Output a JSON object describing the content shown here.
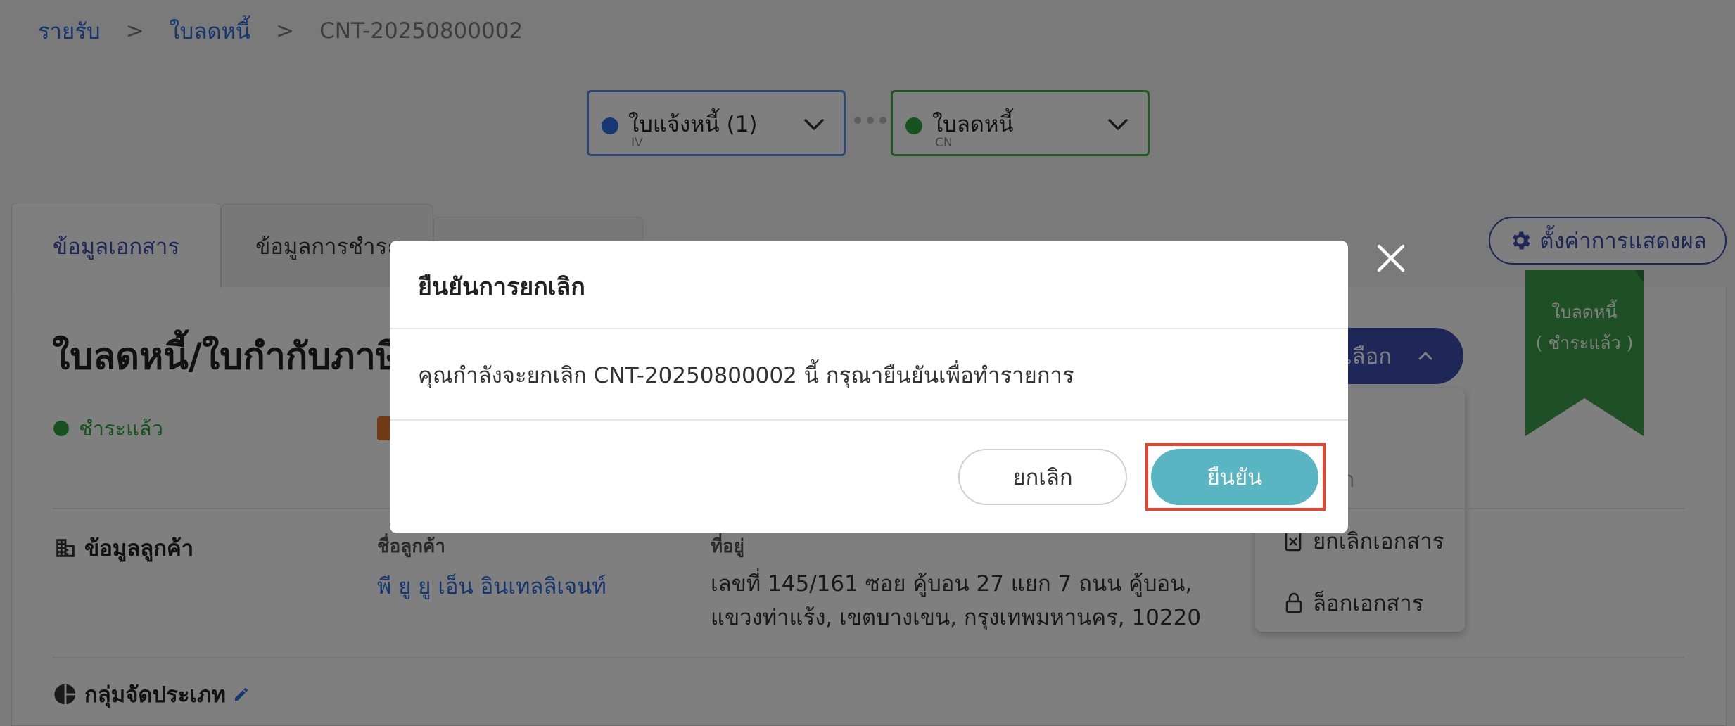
{
  "breadcrumb": {
    "items": [
      "รายรับ",
      "ใบลดหนี้",
      "CNT-20250800002"
    ],
    "separator": ">"
  },
  "doc_flow": {
    "invoice": {
      "title": "ใบแจ้งหนี้ (1)",
      "code": "IV"
    },
    "credit_note": {
      "title": "ใบลดหนี้",
      "code": "CN"
    }
  },
  "tabs": [
    "ข้อมูลเอกสาร",
    "ข้อมูลการชำระ"
  ],
  "settings_button": "ตั้งค่าการแสดงผล",
  "document": {
    "title": "ใบลดหนี้/ใบกำกับภาษี เล",
    "status": "ชำระแล้ว",
    "ribbon_line1": "ใบลดหนี้",
    "ribbon_line2": "( ชำระแล้ว )"
  },
  "options_menu": {
    "button_label": "เลือก",
    "items": [
      "",
      "อก",
      "ยกเลิกเอกสาร",
      "ล็อกเอกสาร"
    ]
  },
  "customer": {
    "section_title": "ข้อมูลลูกค้า",
    "name_label": "ชื่อลูกค้า",
    "name": "พี ยู ยู เอ็น อินเทลลิเจนท์",
    "address_label": "ที่อยู่",
    "address": "เลขที่ 145/161 ซอย คู้บอน 27 แยก 7 ถนน คู้บอน, แขวงท่าแร้ง, เขตบางเขน, กรุงเทพมหานคร, 10220"
  },
  "category": {
    "section_title": "กลุ่มจัดประเภท"
  },
  "modal": {
    "title": "ยืนยันการยกเลิก",
    "message": "คุณกำลังจะยกเลิก CNT-20250800002 นี้ กรุณายืนยันเพื่อทำรายการ",
    "cancel_label": "ยกเลิก",
    "confirm_label": "ยืนยัน"
  },
  "colors": {
    "brand": "#3d4fb0",
    "link": "#2f6ee0",
    "paid": "#2fa33a",
    "confirm": "#5ab5c3",
    "highlight": "#e8432e"
  }
}
